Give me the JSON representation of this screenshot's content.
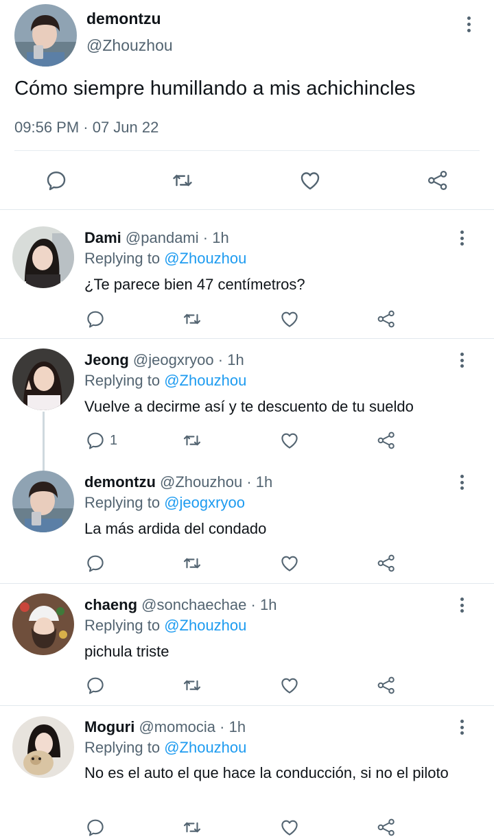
{
  "main_tweet": {
    "name": "demontzu",
    "handle": "@Zhouzhou",
    "text": "Cómo siempre humillando a mis achichincles",
    "timestamp": "09:56 PM · 07 Jun 22",
    "actions": [
      "reply-icon",
      "retweet-icon",
      "like-icon",
      "share-icon"
    ]
  },
  "replies": [
    {
      "name": "Dami",
      "handle": "@pandami",
      "dot": "·",
      "time": "1h",
      "replying_prefix": "Replying to",
      "replying_to": "@Zhouzhou",
      "text": "¿Te parece bien 47 centímetros?",
      "reply_count": ""
    },
    {
      "name": "Jeong",
      "handle": "@jeogxryoo",
      "dot": "·",
      "time": "1h",
      "replying_prefix": "Replying to",
      "replying_to": "@Zhouzhou",
      "text": "Vuelve a decirme así y te descuento de tu sueldo",
      "reply_count": "1"
    },
    {
      "name": "demontzu",
      "handle": "@Zhouzhou",
      "dot": "·",
      "time": "1h",
      "replying_prefix": "Replying to",
      "replying_to": "@jeogxryoo",
      "text": "La más ardida del condado",
      "reply_count": ""
    },
    {
      "name": "chaeng",
      "handle": "@sonchaechae",
      "dot": "·",
      "time": "1h",
      "replying_prefix": "Replying to",
      "replying_to": "@Zhouzhou",
      "text": "pichula triste",
      "reply_count": ""
    },
    {
      "name": "Moguri",
      "handle": "@momocia",
      "dot": "·",
      "time": "1h",
      "replying_prefix": "Replying to",
      "replying_to": "@Zhouzhou",
      "text": "No es el auto el que hace la conducción, si no el piloto",
      "reply_count": ""
    }
  ],
  "colors": {
    "text": "#0f1419",
    "secondary": "#536471",
    "mention": "#1d9bf0",
    "divider": "#e1e8ed"
  }
}
